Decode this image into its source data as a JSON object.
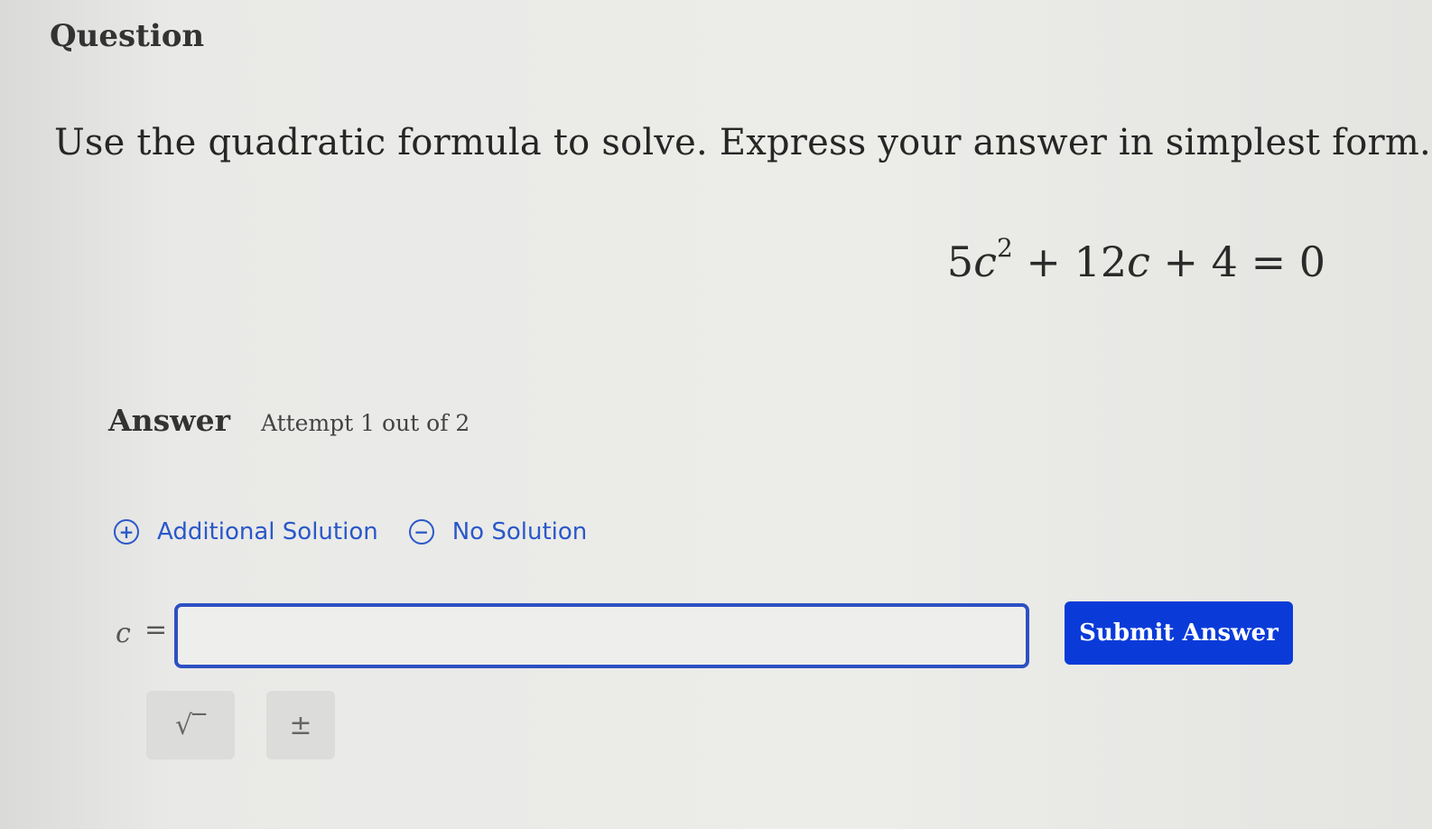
{
  "question": {
    "heading": "Question",
    "prompt": "Use the quadratic formula to solve. Express your answer in simplest form.",
    "equation": {
      "coef_a": "5",
      "var": "c",
      "exponent": "2",
      "middle": " + 12",
      "var2": "c",
      "tail": " + 4 = 0"
    }
  },
  "answer": {
    "label": "Answer",
    "attempt": "Attempt 1 out of 2",
    "options": {
      "additional": "Additional Solution",
      "no_solution": "No Solution"
    },
    "variable": "c",
    "equals": "=",
    "input_value": "",
    "input_placeholder": "",
    "submit_label": "Submit Answer",
    "tools": {
      "sqrt": "√‾",
      "plus_minus": "±"
    }
  }
}
